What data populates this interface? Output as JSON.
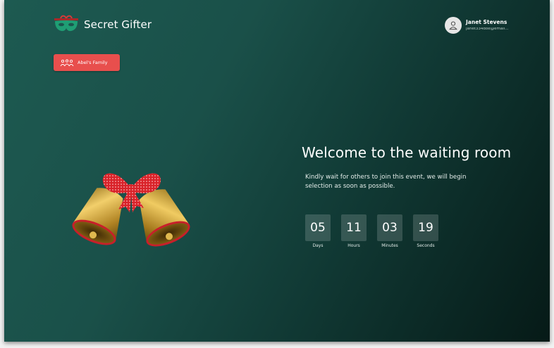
{
  "app": {
    "name": "Secret Gifter"
  },
  "user": {
    "name": "Janet Stevens",
    "email": "janet334doe@email..."
  },
  "group": {
    "label": "Abel's Family"
  },
  "main": {
    "title": "Welcome to the waiting room",
    "subtitle": "Kindly wait for others to join this event, we will begin selection as soon as possible."
  },
  "countdown": [
    {
      "value": "05",
      "label": "Days"
    },
    {
      "value": "11",
      "label": "Hours"
    },
    {
      "value": "03",
      "label": "Minutes"
    },
    {
      "value": "19",
      "label": "Seconds"
    }
  ],
  "icons": {
    "logo": "mask-gift-icon",
    "avatar": "user-icon",
    "group": "people-group-icon",
    "illustration": "christmas-bells"
  },
  "colors": {
    "accent": "#e84f4d",
    "background_start": "#1d5a51",
    "background_end": "#061a17",
    "logo_mask": "#1f9e74"
  }
}
